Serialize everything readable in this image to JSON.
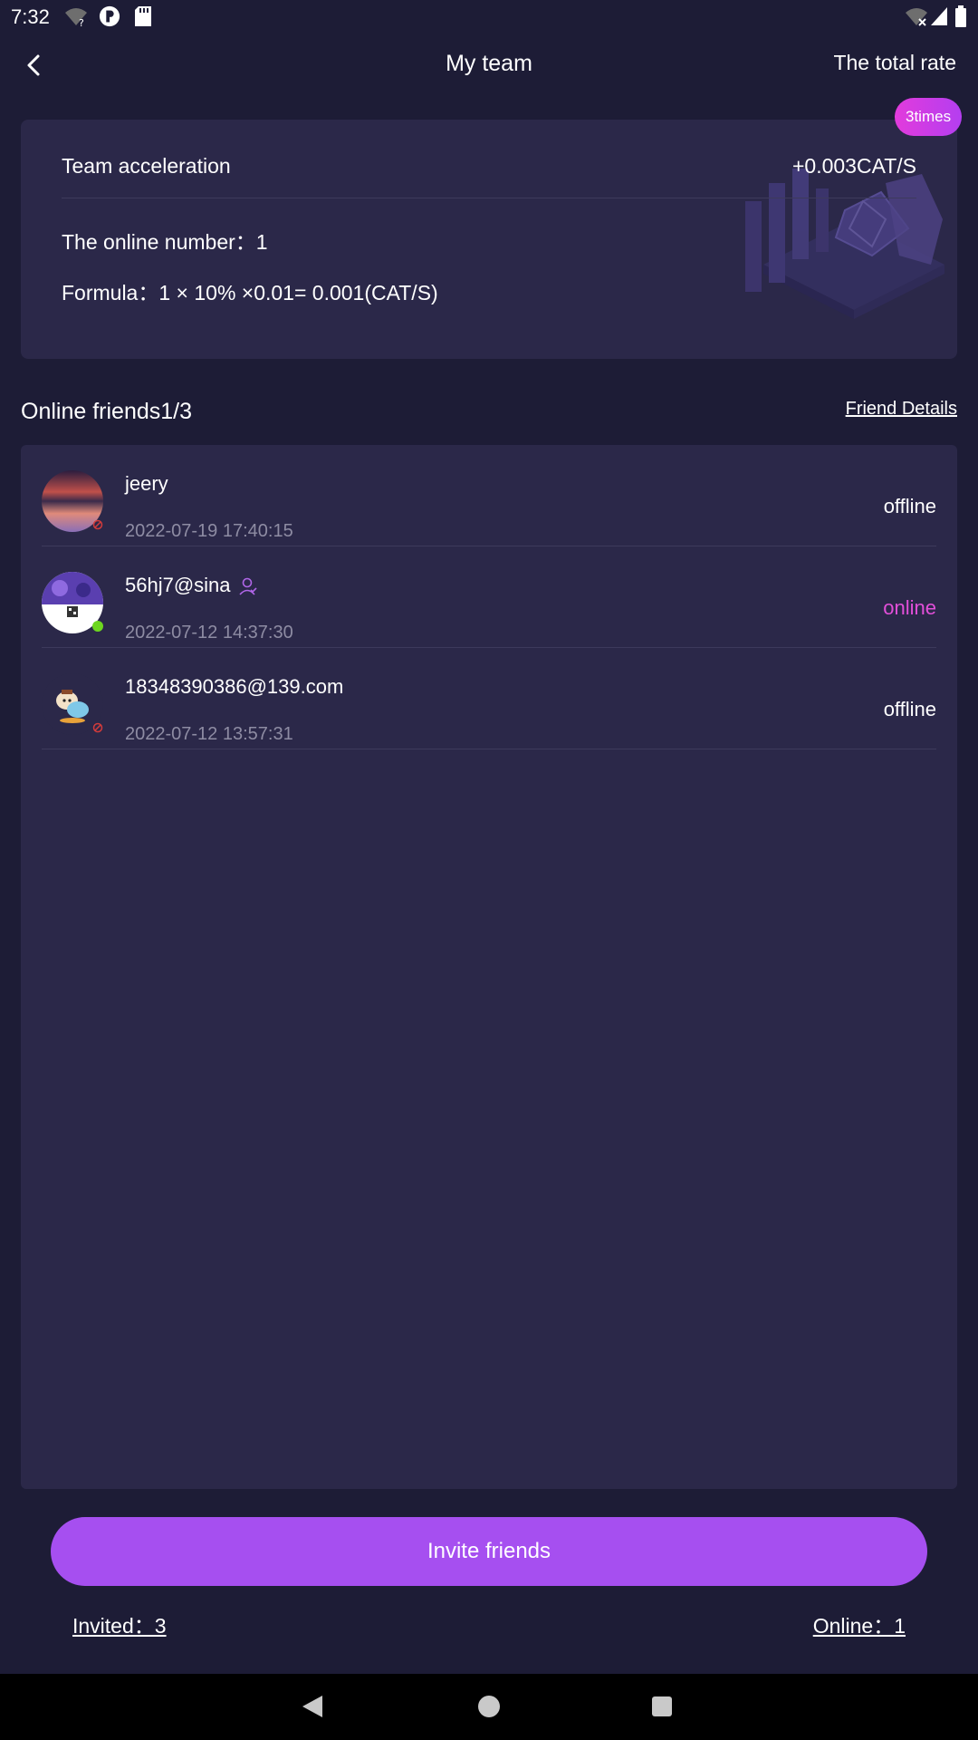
{
  "status_bar": {
    "time": "7:32",
    "icons": [
      "wifi-question-icon",
      "p-circle-icon",
      "sd-card-icon",
      "wifi-x-icon",
      "signal-icon",
      "battery-icon"
    ]
  },
  "header": {
    "title": "My team",
    "right_link": "The total rate"
  },
  "accel_card": {
    "badge": "3times",
    "label": "Team acceleration",
    "value": "+0.003CAT/S",
    "online_number": "The online number：1",
    "formula": "Formula：1 × 10% ×0.01= 0.001(CAT/S)"
  },
  "friends": {
    "title": "Online friends1/3",
    "details_link": "Friend Details",
    "items": [
      {
        "name": "jeery",
        "time": "2022-07-19 17:40:15",
        "status": "offline"
      },
      {
        "name": "56hj7@sina",
        "time": "2022-07-12 14:37:30",
        "status": "online"
      },
      {
        "name": "18348390386@139.com",
        "time": "2022-07-12 13:57:31",
        "status": "offline"
      }
    ]
  },
  "footer": {
    "invite_button": "Invite friends",
    "invited": "Invited：3",
    "online": "Online：1"
  },
  "colors": {
    "background": "#1d1c36",
    "card": "#2b2849",
    "accent": "#a64ff0",
    "online": "#e24fd9",
    "online_dot": "#6dd61f",
    "muted_text": "#8e8ca3"
  }
}
